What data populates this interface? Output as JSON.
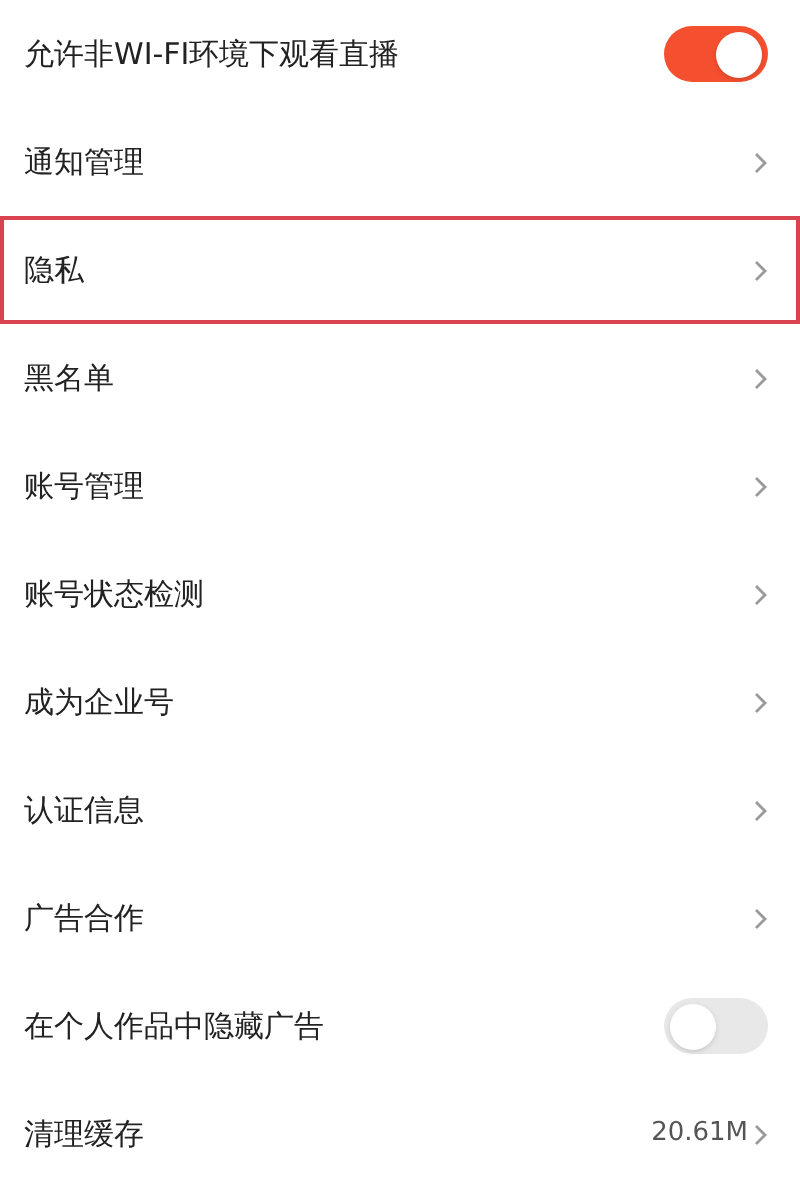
{
  "settings": [
    {
      "kind": "toggle",
      "label": "允许非WI-FI环境下观看直播",
      "on": true,
      "highlighted": false
    },
    {
      "kind": "link",
      "label": "通知管理",
      "highlighted": false
    },
    {
      "kind": "link",
      "label": "隐私",
      "highlighted": true
    },
    {
      "kind": "link",
      "label": "黑名单",
      "highlighted": false
    },
    {
      "kind": "link",
      "label": "账号管理",
      "highlighted": false
    },
    {
      "kind": "link",
      "label": "账号状态检测",
      "highlighted": false
    },
    {
      "kind": "link",
      "label": "成为企业号",
      "highlighted": false
    },
    {
      "kind": "link",
      "label": "认证信息",
      "highlighted": false
    },
    {
      "kind": "link",
      "label": "广告合作",
      "highlighted": false
    },
    {
      "kind": "toggle",
      "label": "在个人作品中隐藏广告",
      "on": false,
      "highlighted": false
    },
    {
      "kind": "link",
      "label": "清理缓存",
      "value": "20.61M",
      "highlighted": false
    }
  ]
}
